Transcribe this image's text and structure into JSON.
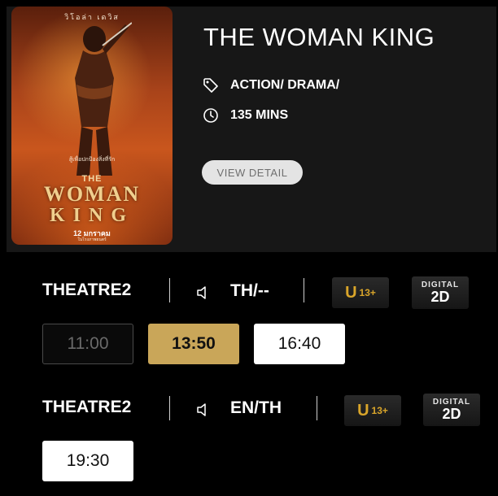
{
  "movie": {
    "title": "THE WOMAN KING",
    "genre": "ACTION/ DRAMA/",
    "duration": "135 MINS",
    "view_detail_label": "VIEW DETAIL",
    "genre_icon": "tag-icon",
    "duration_icon": "clock-icon",
    "poster": {
      "thai_top": "วิโอล่า  เดวิส",
      "tagline": "สู้เพื่อปกป้องสิ่งที่รัก",
      "title_the": "THE",
      "title_woman": "WOMAN",
      "title_king": "KING",
      "date": "12 มกราคม",
      "sub": "ในโรงภาพยนตร์"
    }
  },
  "showtimes": [
    {
      "theatre": "THEATRE2",
      "audio_icon": "speaker-icon",
      "language": "TH/--",
      "rating_letter": "U",
      "rating_age": "13+",
      "format_top": "DIGITAL",
      "format_bottom": "2D",
      "times": [
        {
          "time": "11:00",
          "state": "past"
        },
        {
          "time": "13:50",
          "state": "selected"
        },
        {
          "time": "16:40",
          "state": "available"
        }
      ]
    },
    {
      "theatre": "THEATRE2",
      "audio_icon": "speaker-icon",
      "language": "EN/TH",
      "rating_letter": "U",
      "rating_age": "13+",
      "format_top": "DIGITAL",
      "format_bottom": "2D",
      "times": [
        {
          "time": "19:30",
          "state": "available"
        }
      ]
    }
  ],
  "colors": {
    "background": "#000000",
    "card": "#171717",
    "selected_time": "#c9a659",
    "rating_gold": "#d9a52a"
  }
}
